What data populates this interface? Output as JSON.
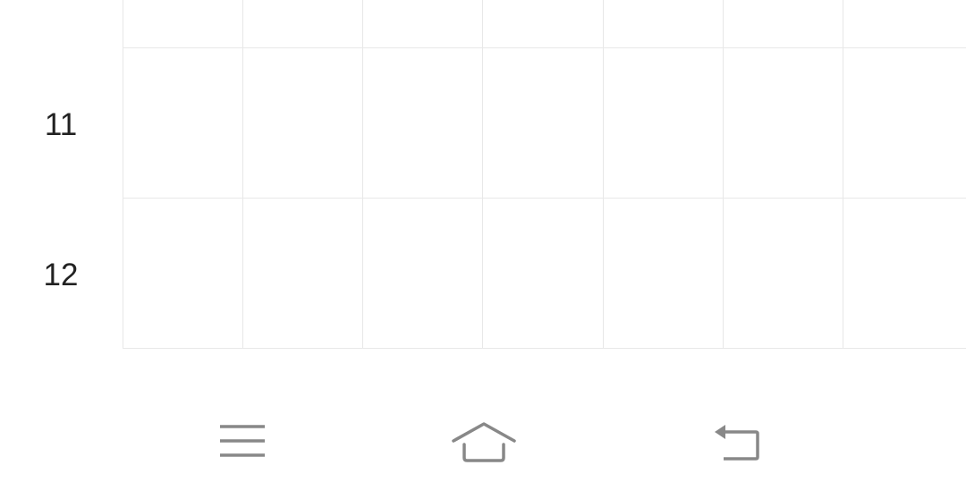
{
  "timetable": {
    "hours": [
      "11",
      "12"
    ],
    "day_columns": 7
  },
  "nav_bar": {
    "icon_color": "#888888",
    "buttons": [
      {
        "name": "menu",
        "icon": "menu-icon"
      },
      {
        "name": "home",
        "icon": "home-icon"
      },
      {
        "name": "back",
        "icon": "back-icon"
      }
    ]
  },
  "colors": {
    "grid_line": "#e8e8e8",
    "hour_text": "#222222",
    "background": "#ffffff"
  }
}
